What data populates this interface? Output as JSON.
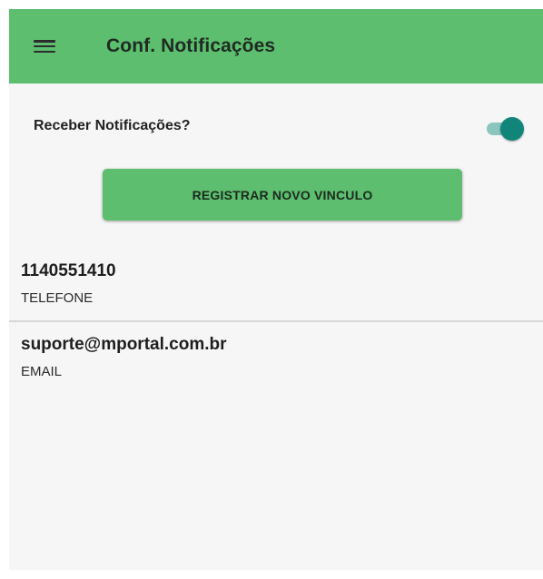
{
  "toolbar": {
    "title": "Conf. Notificações",
    "menu_icon": "hamburger-menu-icon"
  },
  "notifications": {
    "label": "Receber Notificações?",
    "enabled": true
  },
  "register_button": {
    "label": "REGISTRAR NOVO VINCULO"
  },
  "contacts": [
    {
      "value": "1140551410",
      "type": "TELEFONE"
    },
    {
      "value": "suporte@mportal.com.br",
      "type": "EMAIL"
    }
  ],
  "colors": {
    "toolbar": "#5cbe6e",
    "button": "#5cbe6e",
    "switch_thumb": "#12857a",
    "switch_track": "#8cc5bd",
    "background": "#f6f6f6"
  }
}
